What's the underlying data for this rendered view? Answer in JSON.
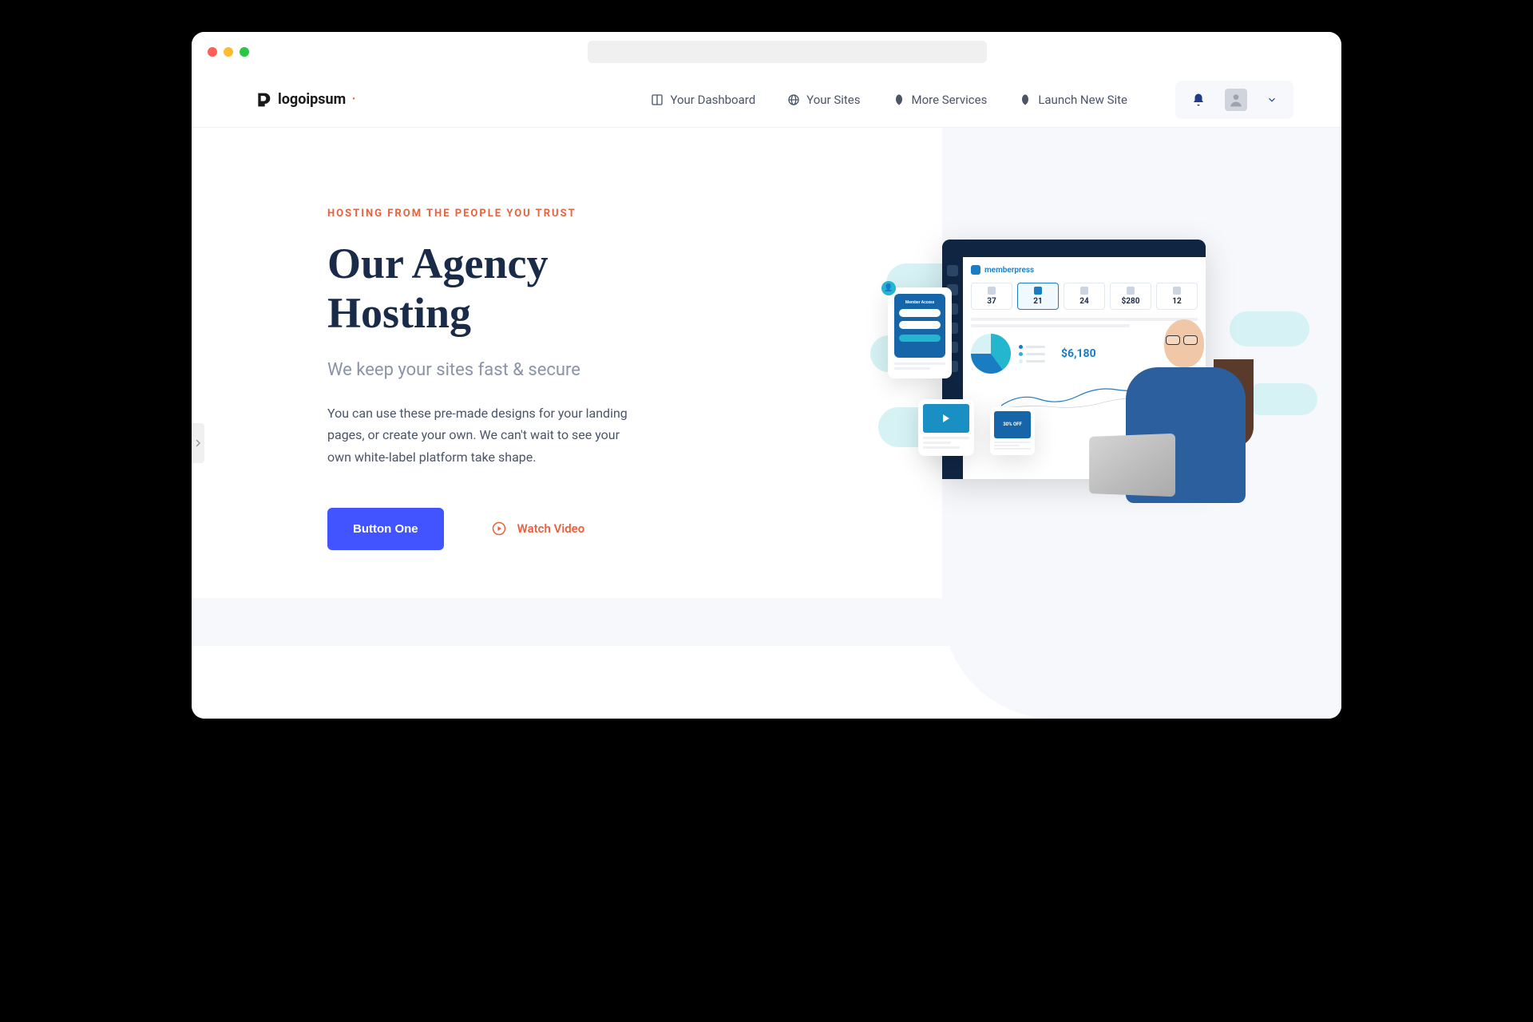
{
  "brand": {
    "name": "logoipsum"
  },
  "nav": {
    "items": [
      {
        "label": "Your Dashboard"
      },
      {
        "label": "Your Sites"
      },
      {
        "label": "More Services"
      },
      {
        "label": "Launch New Site"
      }
    ]
  },
  "hero": {
    "eyebrow": "HOSTING FROM THE PEOPLE YOU TRUST",
    "headline": "Our Agency Hosting",
    "subhead": "We keep your sites fast & secure",
    "body": "You can use these pre-made designs for your landing pages, or create your own. We can't wait to see your own white-label platform take shape.",
    "primary_cta": "Button One",
    "secondary_cta": "Watch Video"
  },
  "illustration": {
    "dashboard_brand": "memberpress",
    "stats": [
      {
        "value": "37"
      },
      {
        "value": "21"
      },
      {
        "value": "24"
      },
      {
        "value": "$280"
      },
      {
        "value": "12"
      }
    ],
    "revenue": "$6,180",
    "login_title": "Member Access",
    "offer_text": "30% OFF"
  }
}
